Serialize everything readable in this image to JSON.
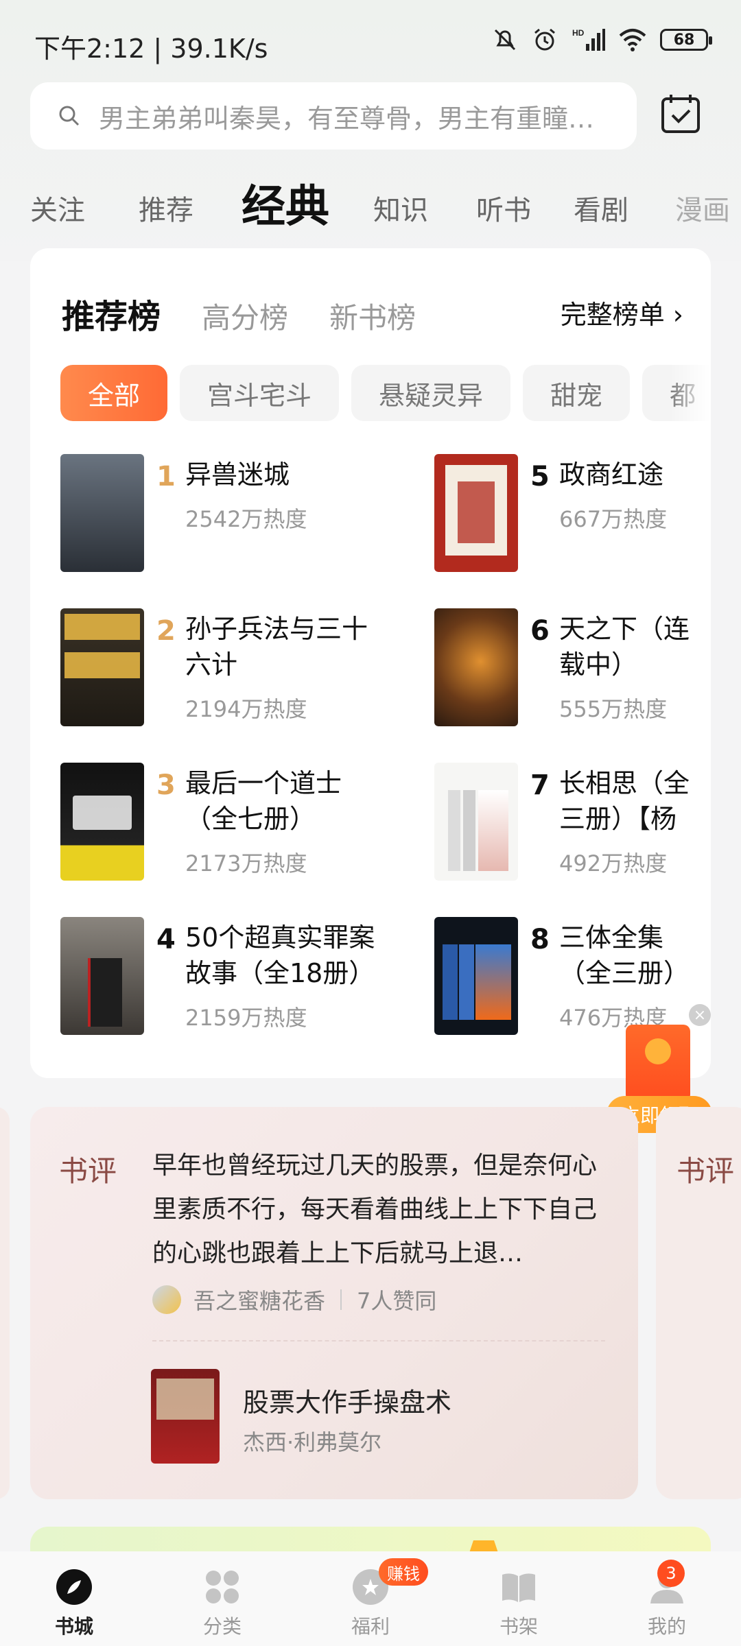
{
  "status_bar": {
    "time": "下午2:12 | 39.1K/s",
    "battery": "68"
  },
  "search": {
    "placeholder": "男主弟弟叫秦昊，有至尊骨，男主有重瞳…"
  },
  "tabs": [
    "关注",
    "推荐",
    "经典",
    "知识",
    "听书",
    "看剧",
    "漫画"
  ],
  "active_tab": "经典",
  "ranking": {
    "subtabs": [
      "推荐榜",
      "高分榜",
      "新书榜"
    ],
    "full_list": "完整榜单 ›",
    "chips": [
      "全部",
      "宫斗宅斗",
      "悬疑灵异",
      "甜宠",
      "都"
    ],
    "books": [
      {
        "rank": "1",
        "title": "异兽迷城",
        "heat": "2542万热度",
        "cover_color": "#3a4048"
      },
      {
        "rank": "2",
        "title": "孙子兵法与三十六计",
        "heat": "2194万热度",
        "cover_color": "#2b2520"
      },
      {
        "rank": "3",
        "title": "最后一个道士（全七册）",
        "heat": "2173万热度",
        "cover_color": "#1a1a1a"
      },
      {
        "rank": "4",
        "title": "50个超真实罪案故事（全18册）",
        "heat": "2159万热度",
        "cover_color": "#5a5550"
      },
      {
        "rank": "5",
        "title": "政商红途",
        "heat": "667万热度",
        "cover_color": "#b22a1e"
      },
      {
        "rank": "6",
        "title": "天之下（连载中）",
        "heat": "555万热度",
        "cover_color": "#3a2a1a"
      },
      {
        "rank": "7",
        "title": "长相思（全三册）【杨紫",
        "heat": "492万热度",
        "cover_color": "#f0f0ee"
      },
      {
        "rank": "8",
        "title": "三体全集（全三册）",
        "heat": "476万热度",
        "cover_color": "#101820"
      }
    ]
  },
  "red_packet": {
    "button": "立即领取",
    "close": "×"
  },
  "review": {
    "tag": "书评",
    "text": "早年也曾经玩过几天的股票，但是奈何心里素质不行，每天看着曲线上上下下自己的心跳也跟着上上下后就马上退…",
    "user": "吾之蜜糖花香",
    "likes": "7人赞同",
    "book_title": "股票大作手操盘术",
    "book_author": "杰西·利弗莫尔",
    "next_tag": "书评"
  },
  "nav": {
    "items": [
      "书城",
      "分类",
      "福利",
      "书架",
      "我的"
    ],
    "earn_badge": "赚钱",
    "mine_badge": "3"
  }
}
